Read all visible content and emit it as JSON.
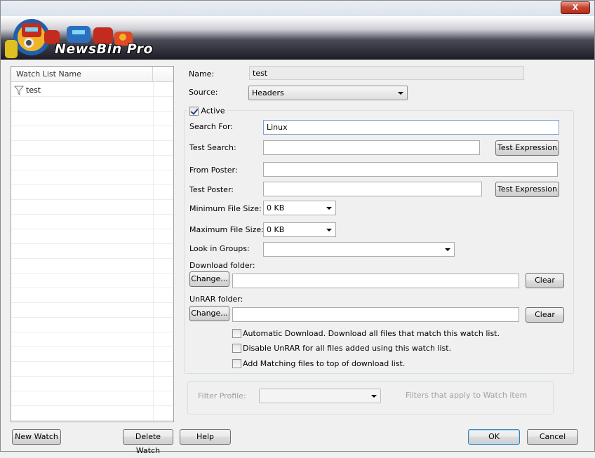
{
  "window": {
    "close_label": "X"
  },
  "banner": {
    "logo_text": "NewsBin Pro"
  },
  "watch_list": {
    "column_header": "Watch List Name",
    "items": [
      {
        "label": "test",
        "icon": "filter-icon"
      }
    ]
  },
  "form": {
    "name_label": "Name:",
    "name_value": "test",
    "source_label": "Source:",
    "source_value": "Headers",
    "active_label": "Active",
    "active_checked": true,
    "search_for_label": "Search For:",
    "search_for_value": "Linux",
    "test_search_label": "Test Search:",
    "test_search_value": "",
    "test_expression_label": "Test Expression",
    "from_poster_label": "From Poster:",
    "from_poster_value": "",
    "test_poster_label": "Test Poster:",
    "test_poster_value": "",
    "min_size_label": "Minimum File Size:",
    "min_size_value": "0 KB",
    "max_size_label": "Maximum File Size:",
    "max_size_value": "0 KB",
    "look_in_groups_label": "Look in Groups:",
    "look_in_groups_value": "",
    "download_folder_label": "Download folder:",
    "download_folder_value": "",
    "unrar_folder_label": "UnRAR folder:",
    "unrar_folder_value": "",
    "change_label": "Change...",
    "clear_label": "Clear",
    "auto_download_label": "Automatic Download. Download all files that match this watch list.",
    "disable_unrar_label": "Disable UnRAR for all files added using this watch list.",
    "add_top_label": "Add Matching files to top of download list."
  },
  "filter": {
    "profile_label": "Filter Profile:",
    "profile_value": "",
    "hint": "Filters that apply to Watch item"
  },
  "buttons": {
    "new_watch": "New Watch",
    "delete_watch": "Delete Watch",
    "help": "Help",
    "ok": "OK",
    "cancel": "Cancel"
  }
}
